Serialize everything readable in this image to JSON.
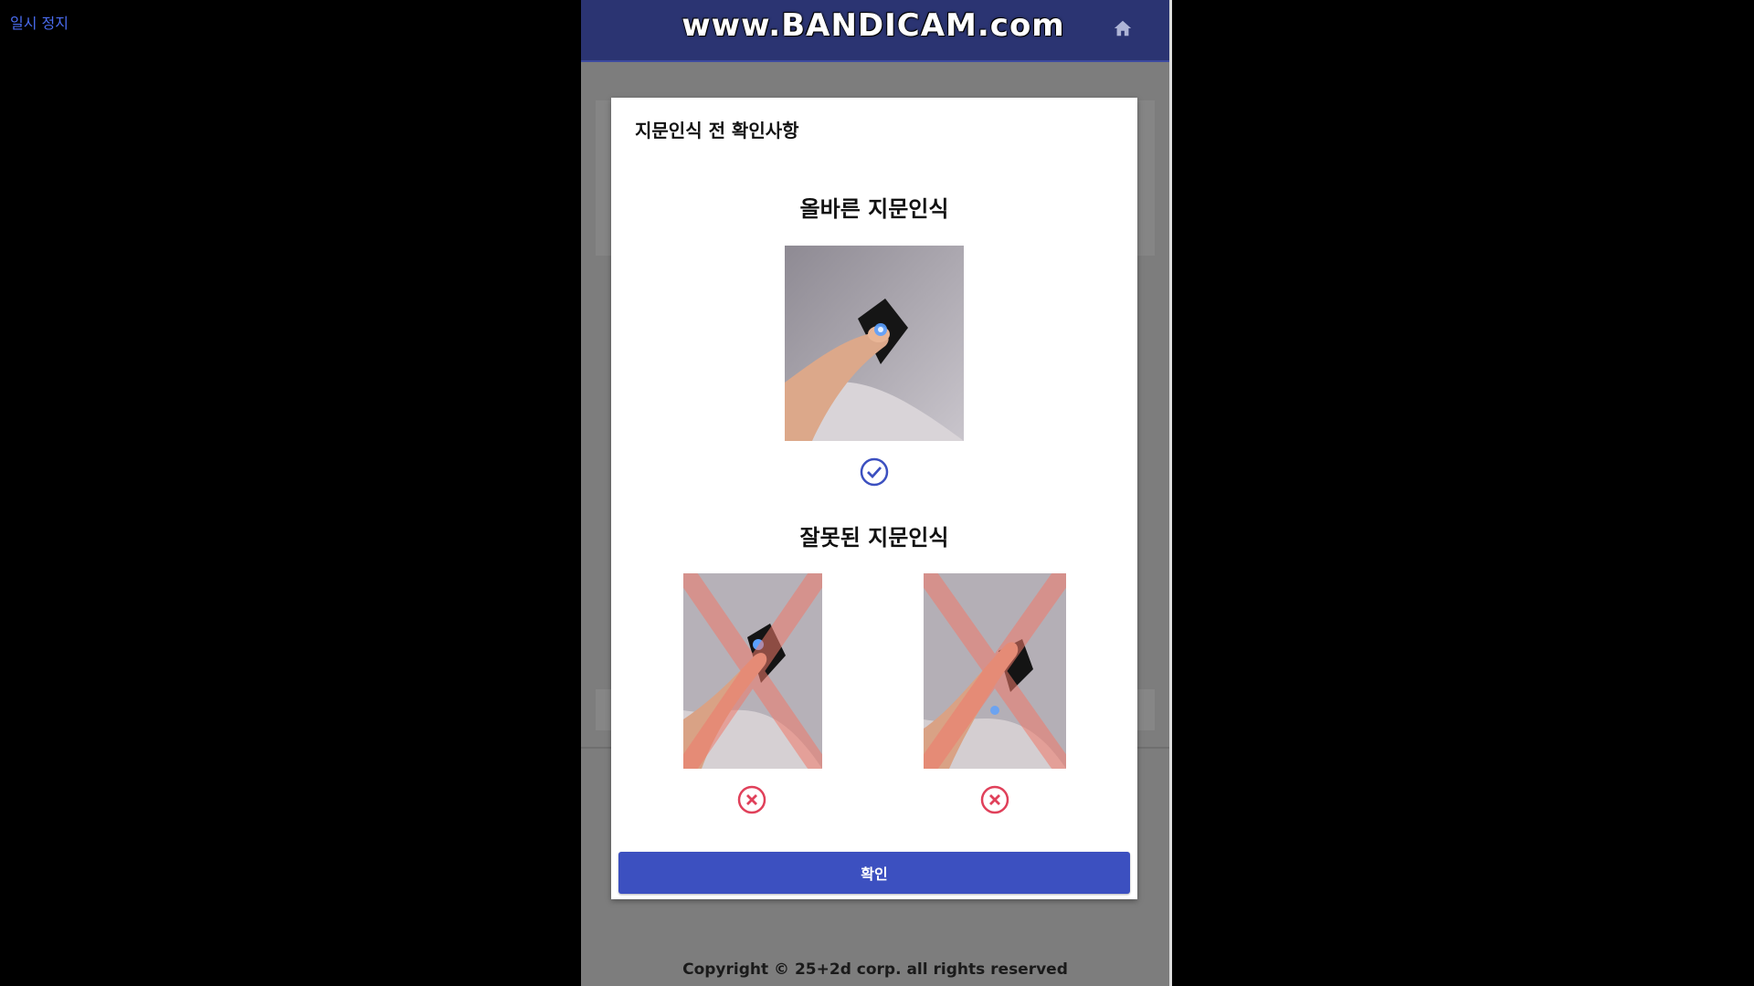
{
  "player": {
    "pause_label": "일시 정지"
  },
  "header": {
    "brand": "www.BANDICAM.com"
  },
  "modal": {
    "title": "지문인식 전 확인사항",
    "correct_title": "올바른 지문인식",
    "wrong_title": "잘못된 지문인식",
    "confirm_label": "확인"
  },
  "footer": {
    "copyright": "Copyright © 25+2d corp. all rights reserved"
  },
  "icons": {
    "home": "home-icon",
    "correct": "check-circle-icon",
    "wrong": "x-circle-icon"
  },
  "colors": {
    "header_bg": "#2b3472",
    "confirm_bg": "#3c50c0",
    "check": "#3c50c0",
    "wrong": "#e0405a"
  }
}
